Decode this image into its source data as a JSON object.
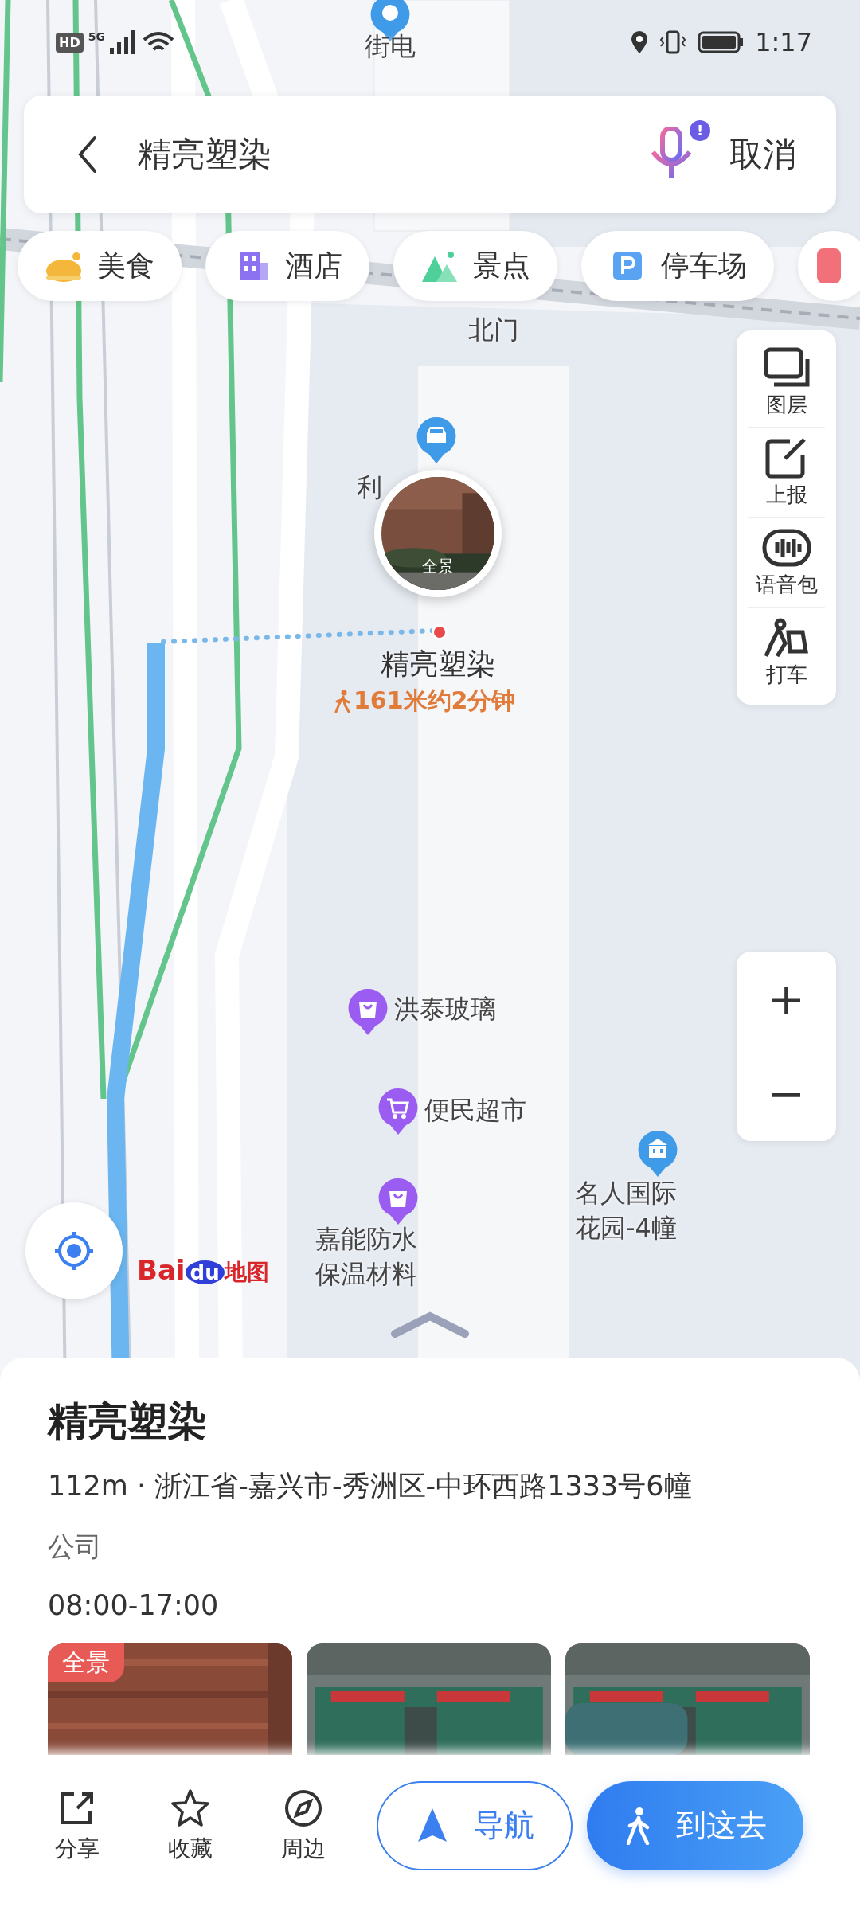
{
  "status_bar": {
    "hd": "HD",
    "network": "5G",
    "time": "1:17"
  },
  "search": {
    "value": "精亮塑染",
    "voice_badge": "!",
    "cancel": "取消"
  },
  "categories": [
    {
      "label": "美食",
      "kind": "food"
    },
    {
      "label": "酒店",
      "kind": "hotel"
    },
    {
      "label": "景点",
      "kind": "scenic"
    },
    {
      "label": "停车场",
      "kind": "parking"
    }
  ],
  "map": {
    "labels": [
      {
        "text": "街电",
        "kind": "power"
      },
      {
        "text": "北门",
        "kind": "gate"
      },
      {
        "text": "利",
        "kind": "car"
      },
      {
        "text": "洪泰玻璃",
        "kind": "shop"
      },
      {
        "text": "便民超市",
        "kind": "market"
      },
      {
        "text": "嘉能防水保温材料",
        "kind": "shop"
      },
      {
        "text": "名人国际花园-4幢",
        "kind": "building"
      }
    ],
    "logo": [
      "Bai",
      "du",
      "地图"
    ]
  },
  "tools": [
    {
      "label": "图层",
      "kind": "layers"
    },
    {
      "label": "上报",
      "kind": "report"
    },
    {
      "label": "语音包",
      "kind": "voice"
    },
    {
      "label": "打车",
      "kind": "taxi"
    }
  ],
  "zoom": {
    "in": "+",
    "out": "−"
  },
  "place": {
    "name": "精亮塑染",
    "walk": "161米约2分钟",
    "panorama": "全景"
  },
  "sheet": {
    "title": "精亮塑染",
    "address": "112m · 浙江省-嘉兴市-秀洲区-中环西路1333号6幢",
    "category": "公司",
    "hours": "08:00-17:00",
    "photos": [
      {
        "kind": "picture",
        "tag": "全景"
      },
      {
        "kind": "picture"
      },
      {
        "kind": "picture"
      }
    ]
  },
  "actions": [
    {
      "label": "分享",
      "kind": "share"
    },
    {
      "label": "收藏",
      "kind": "favorite"
    },
    {
      "label": "周边",
      "kind": "nearby"
    }
  ],
  "buttons": [
    {
      "label": "导航",
      "kind": "navigate"
    },
    {
      "label": "到这去",
      "kind": "go"
    }
  ]
}
